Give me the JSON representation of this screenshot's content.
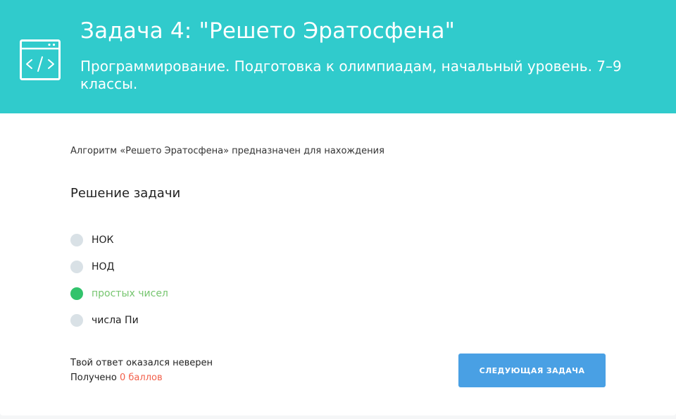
{
  "header": {
    "title": "Задача 4:  \"Решето Эратосфена\"",
    "subtitle": "Программирование. Подготовка к олимпиадам, начальный уровень. 7–9 классы.",
    "icon": "code-window-icon",
    "background_color": "#30cbcc"
  },
  "question": {
    "text": "Алгоритм «Решето Эратосфена» предназначен для нахождения"
  },
  "solution": {
    "heading": "Решение задачи",
    "options": [
      {
        "label": "НОК",
        "selected": false
      },
      {
        "label": "НОД",
        "selected": false
      },
      {
        "label": "простых чисел",
        "selected": true,
        "correct": true
      },
      {
        "label": "числа Пи",
        "selected": false
      }
    ]
  },
  "result": {
    "message": "Твой ответ оказался неверен",
    "points_prefix": "Получено ",
    "points_value": "0 баллов"
  },
  "next_button": {
    "label": "СЛЕДУЮЩАЯ ЗАДАЧА",
    "color": "#49a0e4"
  }
}
